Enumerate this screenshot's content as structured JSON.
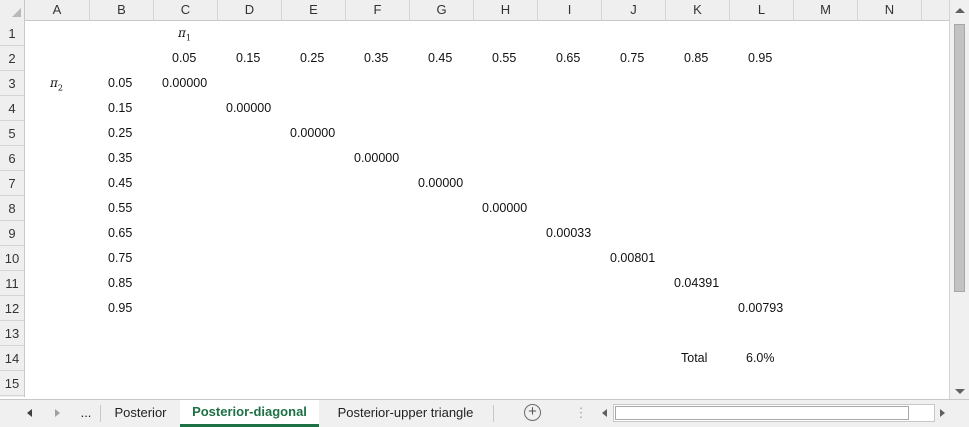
{
  "columns": [
    "A",
    "B",
    "C",
    "D",
    "E",
    "F",
    "G",
    "H",
    "I",
    "J",
    "K",
    "L",
    "M",
    "N"
  ],
  "rows": [
    "1",
    "2",
    "3",
    "4",
    "5",
    "6",
    "7",
    "8",
    "9",
    "10",
    "11",
    "12",
    "13",
    "14",
    "15"
  ],
  "axis_labels": {
    "pi1": {
      "symbol": "π",
      "sub": "1"
    },
    "pi2": {
      "symbol": "π",
      "sub": "2"
    }
  },
  "header_values": [
    "0.05",
    "0.15",
    "0.25",
    "0.35",
    "0.45",
    "0.55",
    "0.65",
    "0.75",
    "0.85",
    "0.95"
  ],
  "row_values": [
    "0.05",
    "0.15",
    "0.25",
    "0.35",
    "0.45",
    "0.55",
    "0.65",
    "0.75",
    "0.85",
    "0.95"
  ],
  "diagonal_values": [
    "0.00000",
    "0.00000",
    "0.00000",
    "0.00000",
    "0.00000",
    "0.00000",
    "0.00033",
    "0.00801",
    "0.04391",
    "0.00793"
  ],
  "total": {
    "label": "Total",
    "value": "6.0%"
  },
  "tabs": {
    "ellipsis": "...",
    "items": [
      {
        "label": "Posterior",
        "active": false
      },
      {
        "label": "Posterior-diagonal",
        "active": true
      },
      {
        "label": "Posterior-upper triangle",
        "active": false
      }
    ],
    "add": "+",
    "options": "⋮"
  },
  "colors": {
    "accent": "#1e7145",
    "header_bg": "#efefef",
    "grid_line": "#d4d4d4"
  }
}
